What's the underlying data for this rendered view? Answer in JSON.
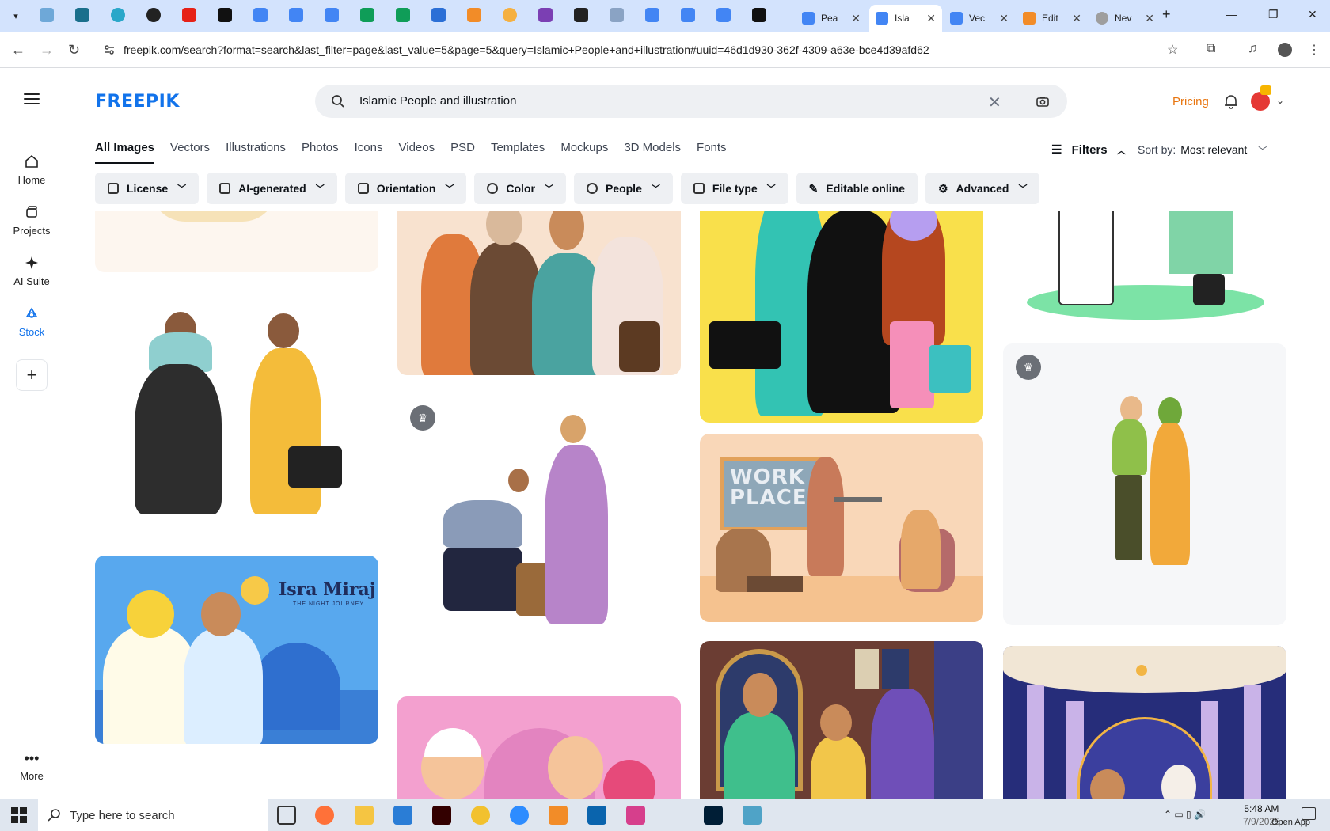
{
  "browser": {
    "url": "freepik.com/search?format=search&last_filter=page&last_value=5&page=5&query=Islamic+People+and+illustration#uuid=46d1d930-362f-4309-a63e-bce4d39afd62",
    "tabs": [
      {
        "title": "Pea",
        "active": false
      },
      {
        "title": "Isla",
        "active": true
      },
      {
        "title": "Vec",
        "active": false
      },
      {
        "title": "Edit",
        "active": false
      },
      {
        "title": "Nev",
        "active": false
      }
    ]
  },
  "rail": {
    "items": [
      {
        "label": "Home",
        "icon": "home-icon"
      },
      {
        "label": "Projects",
        "icon": "projects-icon"
      },
      {
        "label": "AI Suite",
        "icon": "ai-suite-icon"
      },
      {
        "label": "Stock",
        "icon": "stock-icon",
        "active": true
      }
    ],
    "more_label": "More"
  },
  "header": {
    "logo": "FREEPIK",
    "search_value": "Islamic People and illustration",
    "pricing_label": "Pricing"
  },
  "type_tabs": [
    "All Images",
    "Vectors",
    "Illustrations",
    "Photos",
    "Icons",
    "Videos",
    "PSD",
    "Templates",
    "Mockups",
    "3D Models",
    "Fonts"
  ],
  "filters_label": "Filters",
  "sort": {
    "label": "Sort by:",
    "value": "Most relevant"
  },
  "chips": [
    "License",
    "AI-generated",
    "Orientation",
    "Color",
    "People",
    "File type",
    "Editable online",
    "Advanced"
  ],
  "card_texts": {
    "isra_title": "Isra Miraj",
    "isra_sub": "THE NIGHT JOURNEY",
    "workplace_line1": "WORK",
    "workplace_line2": "PLACE"
  },
  "taskbar": {
    "search_placeholder": "Type here to search",
    "time": "5:48 AM",
    "date": "7/9/2025",
    "open_app": "Open App"
  },
  "colors": {
    "brand": "#1273eb",
    "pricing": "#e8750f",
    "tabstrip": "#d3e3fd"
  }
}
